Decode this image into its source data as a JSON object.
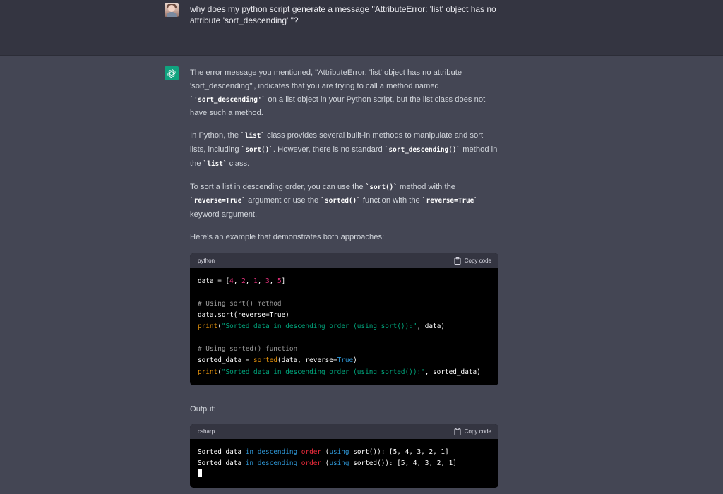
{
  "user_message": "why does my python script generate a message \"AttributeError: 'list' object has no attribute 'sort_descending' \"?",
  "assistant": {
    "p1": {
      "t1": "The error message you mentioned, \"AttributeError: 'list' object has no attribute 'sort_descending'\", indicates that you are trying to call a method named ",
      "c1": "`'sort_descending'`",
      "t2": " on a list object in your Python script, but the list class does not have such a method."
    },
    "p2": {
      "t1": "In Python, the ",
      "c1": "`list`",
      "t2": " class provides several built-in methods to manipulate and sort lists, including ",
      "c2": "`sort()`",
      "t3": ". However, there is no standard ",
      "c3": "`sort_descending()`",
      "t4": " method in the ",
      "c4": "`list`",
      "t5": " class."
    },
    "p3": {
      "t1": "To sort a list in descending order, you can use the ",
      "c1": "`sort()`",
      "t2": " method with the ",
      "c2": "`reverse=True`",
      "t3": " argument or use the ",
      "c3": "`sorted()`",
      "t4": " function with the ",
      "c4": "`reverse=True`",
      "t5": " keyword argument."
    },
    "p4": "Here's an example that demonstrates both approaches:",
    "output_label": "Output:"
  },
  "code_blocks": [
    {
      "language": "python",
      "copy_label": "Copy code",
      "lines": [
        "data = [4, 2, 1, 3, 5]",
        "",
        "# Using sort() method",
        "data.sort(reverse=True)",
        "print(\"Sorted data in descending order (using sort()):\", data)",
        "",
        "# Using sorted() function",
        "sorted_data = sorted(data, reverse=True)",
        "print(\"Sorted data in descending order (using sorted()):\", sorted_data)"
      ]
    },
    {
      "language": "csharp",
      "copy_label": "Copy code",
      "lines": [
        "Sorted data in descending order (using sort()): [5, 4, 3, 2, 1]",
        "Sorted data in descending order (using sorted()): [5, 4, 3, 2, 1]"
      ]
    }
  ],
  "colors": {
    "page_bg": "#444654",
    "user_row_bg": "#343541",
    "gpt_logo_bg": "#10a37f",
    "code_bg": "#000000",
    "code_header_bg": "#343541"
  },
  "icons": [
    "user-avatar",
    "chatgpt-logo-icon",
    "clipboard-icon"
  ]
}
